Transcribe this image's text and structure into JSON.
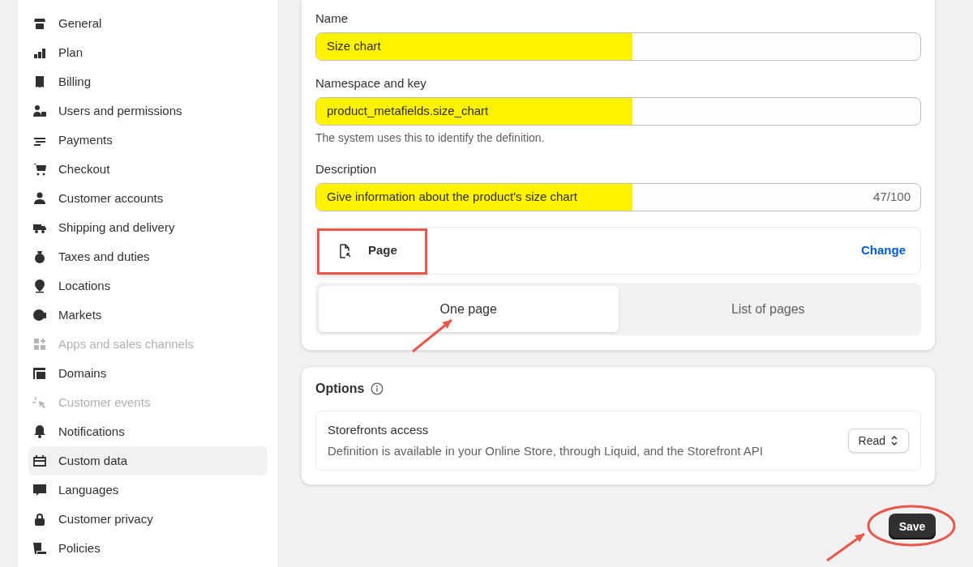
{
  "sidebar": {
    "items": [
      {
        "label": "General",
        "disabled": false,
        "selected": false
      },
      {
        "label": "Plan",
        "disabled": false,
        "selected": false
      },
      {
        "label": "Billing",
        "disabled": false,
        "selected": false
      },
      {
        "label": "Users and permissions",
        "disabled": false,
        "selected": false
      },
      {
        "label": "Payments",
        "disabled": false,
        "selected": false
      },
      {
        "label": "Checkout",
        "disabled": false,
        "selected": false
      },
      {
        "label": "Customer accounts",
        "disabled": false,
        "selected": false
      },
      {
        "label": "Shipping and delivery",
        "disabled": false,
        "selected": false
      },
      {
        "label": "Taxes and duties",
        "disabled": false,
        "selected": false
      },
      {
        "label": "Locations",
        "disabled": false,
        "selected": false
      },
      {
        "label": "Markets",
        "disabled": false,
        "selected": false
      },
      {
        "label": "Apps and sales channels",
        "disabled": true,
        "selected": false
      },
      {
        "label": "Domains",
        "disabled": false,
        "selected": false
      },
      {
        "label": "Customer events",
        "disabled": true,
        "selected": false
      },
      {
        "label": "Notifications",
        "disabled": false,
        "selected": false
      },
      {
        "label": "Custom data",
        "disabled": false,
        "selected": true
      },
      {
        "label": "Languages",
        "disabled": false,
        "selected": false
      },
      {
        "label": "Customer privacy",
        "disabled": false,
        "selected": false
      },
      {
        "label": "Policies",
        "disabled": false,
        "selected": false
      }
    ]
  },
  "definition": {
    "fields": [
      {
        "label": "Name",
        "value": "Size chart",
        "highlighted": true
      },
      {
        "label": "Namespace and key",
        "value": "product_metafields.size_chart",
        "highlighted": true,
        "help": "The system uses this to identify the definition."
      },
      {
        "label": "Description",
        "value": "Give information about the product's size chart",
        "highlighted": true,
        "counter": "47/100"
      }
    ],
    "type": {
      "label": "Page",
      "action": "Change",
      "annotated": true
    },
    "segments": [
      {
        "label": "One page",
        "selected": true,
        "annotated": true
      },
      {
        "label": "List of pages",
        "selected": false,
        "annotated": false
      }
    ]
  },
  "options": {
    "title": "Options",
    "access": {
      "title": "Storefronts access",
      "description": "Definition is available in your Online Store, through Liquid, and the Storefront API",
      "value": "Read"
    }
  },
  "save": {
    "label": "Save",
    "annotated": true
  }
}
